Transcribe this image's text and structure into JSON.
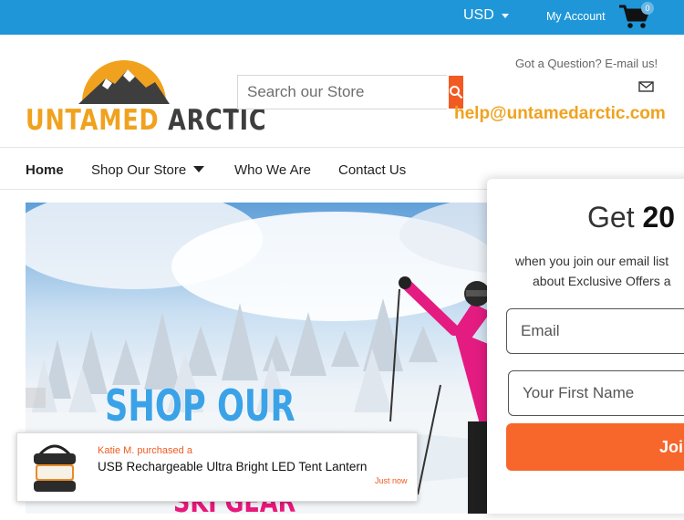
{
  "topbar": {
    "currency": "USD",
    "account_label": "My Account",
    "cart_count": "0"
  },
  "header": {
    "logo_word1": "UNTAMED",
    "logo_word2": "ARCTIC",
    "search_placeholder": "Search our Store",
    "question": "Got a Question? E-mail us!",
    "email": "help@untamedarctic.com"
  },
  "nav": {
    "items": [
      {
        "label": "Home"
      },
      {
        "label": "Shop Our Store"
      },
      {
        "label": "Who We Are"
      },
      {
        "label": "Contact Us"
      }
    ]
  },
  "hero": {
    "line1": "SHOP OUR",
    "line3": "SKI GEAR"
  },
  "popup": {
    "who": "Katie M.  purchased a",
    "product": "USB Rechargeable Ultra Bright LED Tent Lantern",
    "time": "Just now"
  },
  "modal": {
    "title_prefix": "Get ",
    "title_bold": "20",
    "sub1": "when you join our email list",
    "sub2": "about Exclusive Offers a",
    "email_placeholder": "Email",
    "name_placeholder": "Your First Name",
    "button": "Joi"
  },
  "colors": {
    "topbar": "#1e96d8",
    "accent_orange": "#f15a22",
    "logo_gold": "#f0a21e"
  }
}
